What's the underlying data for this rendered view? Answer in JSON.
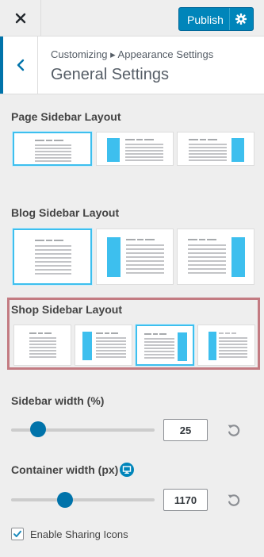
{
  "topbar": {
    "close_icon": "close-icon",
    "publish_label": "Publish",
    "publish_settings_icon": "gear-icon",
    "accent": "#0085ba"
  },
  "header": {
    "back_icon": "chevron-left-icon",
    "breadcrumb": "Customizing ▸ Appearance Settings",
    "title": "General Settings"
  },
  "sections": {
    "page_sidebar_layout": {
      "label": "Page Sidebar Layout",
      "options": [
        "no-sidebar",
        "left-sidebar",
        "right-sidebar"
      ],
      "selected": "no-sidebar"
    },
    "blog_sidebar_layout": {
      "label": "Blog Sidebar Layout",
      "options": [
        "no-sidebar",
        "left-sidebar",
        "right-sidebar"
      ],
      "selected": "no-sidebar"
    },
    "shop_sidebar_layout": {
      "label": "Shop Sidebar Layout",
      "options": [
        "no-sidebar",
        "left-sidebar",
        "right-sidebar",
        "left-sidebar-shop"
      ],
      "selected": "right-sidebar"
    },
    "sidebar_width": {
      "label": "Sidebar width (%)",
      "value": "25",
      "reset_icon": "reset-icon"
    },
    "container_width": {
      "label": "Container width (px)",
      "value": "1170",
      "device_icon": "desktop-icon",
      "reset_icon": "reset-icon"
    },
    "sharing": {
      "label": "Enable Sharing Icons",
      "checked": true
    }
  },
  "colors": {
    "selected_border": "#3dbfee",
    "sidebar_block": "#3dbfee",
    "highlight_box": "#c37b82",
    "slider_thumb": "#0073aa"
  }
}
